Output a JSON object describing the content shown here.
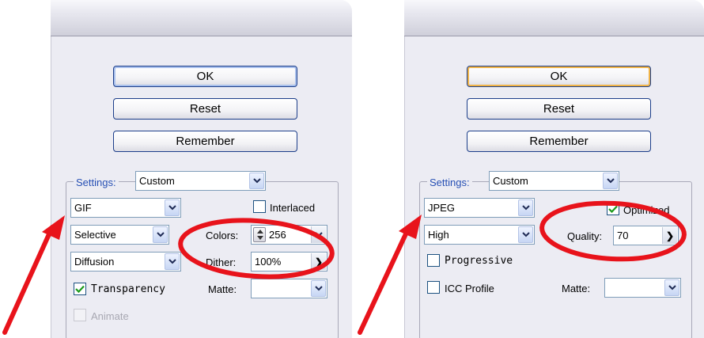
{
  "left_dialog": {
    "buttons": {
      "ok": "OK",
      "reset": "Reset",
      "remember": "Remember"
    },
    "settings_label": "Settings:",
    "settings_value": "Custom",
    "format_value": "GIF",
    "reduction_value": "Selective",
    "dither_algorithm_value": "Diffusion",
    "interlaced_label": "Interlaced",
    "interlaced_checked": false,
    "colors_label": "Colors:",
    "colors_value": "256",
    "dither_label": "Dither:",
    "dither_value": "100%",
    "transparency_label": "Transparency",
    "transparency_checked": true,
    "matte_label": "Matte:",
    "matte_value": "",
    "animate_label": "Animate",
    "animate_checked": false,
    "animate_enabled": false
  },
  "right_dialog": {
    "buttons": {
      "ok": "OK",
      "reset": "Reset",
      "remember": "Remember"
    },
    "settings_label": "Settings:",
    "settings_value": "Custom",
    "format_value": "JPEG",
    "quality_preset_value": "High",
    "optimized_label": "Optimized",
    "optimized_checked": true,
    "quality_label": "Quality:",
    "quality_value": "70",
    "progressive_label": "Progressive",
    "progressive_checked": false,
    "icc_label": "ICC Profile",
    "icc_checked": false,
    "matte_label": "Matte:",
    "matte_value": ""
  },
  "icons": {
    "dropdown": "chevron-down-icon",
    "check": "check-icon",
    "spin": "spin-updown-icon",
    "arrow_right": "chevron-right-icon"
  },
  "colors": {
    "dialog_bg": "#ececf3",
    "group_label": "#2750b4",
    "default_button_focus": "#f0b347",
    "annotation_red": "#e8131b"
  }
}
